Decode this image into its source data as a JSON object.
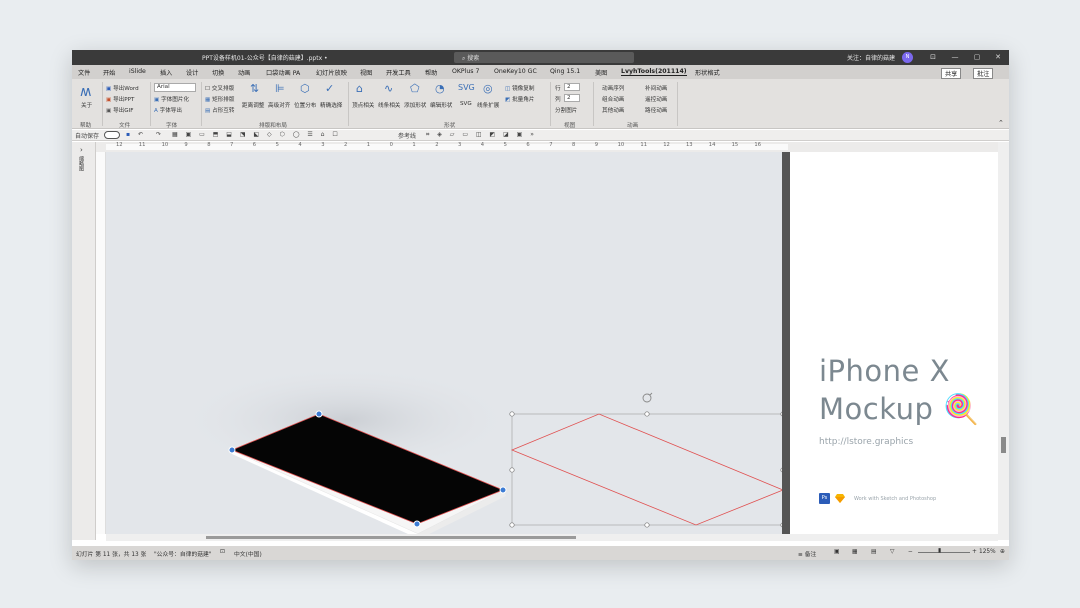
{
  "titlebar": {
    "filename": "PPT设备样机01-公众号【自律的菇建】.pptx  •",
    "search_placeholder": "搜索",
    "follow_text": "关注：自律的菇建",
    "avatar_initial": "N",
    "controls": [
      "⊡",
      "—",
      "▢",
      "✕"
    ]
  },
  "menu": {
    "items": [
      "文件",
      "开始",
      "iSlide",
      "插入",
      "设计",
      "切换",
      "动画",
      "口袋动画 PA",
      "幻灯片放映",
      "视图",
      "开发工具",
      "帮助",
      "OKPlus 7",
      "OneKey10 GC",
      "Qing 15.1",
      "美图",
      "LvyhTools(201114)",
      "形状格式"
    ],
    "active": "LvyhTools(201114)",
    "share": "共享",
    "comment": "批注"
  },
  "ribbon": {
    "help_label": "关于",
    "file_buttons": [
      "导出Word",
      "导出PPT",
      "导出GIF"
    ],
    "font_name": "Arial",
    "font_buttons": [
      "字体图片化",
      "字体导出"
    ],
    "layout_buttons": [
      "交叉排版",
      "矩形排版",
      "占形互转"
    ],
    "layout_large": [
      "距离调整",
      "高级对齐",
      "位置分布",
      "精确选择"
    ],
    "shape_large": [
      "顶点相关",
      "线条相关",
      "添加形状",
      "编辑形状",
      "SVG",
      "线条扩展"
    ],
    "shape_small": [
      "镜像复制",
      "批量角片"
    ],
    "view_rows": [
      "行",
      "列",
      "分割图片"
    ],
    "view_vals": [
      "2",
      "2"
    ],
    "anim_buttons": [
      "动画序列",
      "补间动画",
      "组合动画",
      "遥控动画",
      "其他动画",
      "路径动画"
    ],
    "groups": [
      "帮助",
      "文件",
      "字体",
      "排版和布局",
      "形状",
      "视图",
      "动画"
    ]
  },
  "qat": {
    "autosave": "自动保存",
    "items": [
      "参考线"
    ]
  },
  "ruler": {
    "labels": [
      "12",
      "11",
      "10",
      "9",
      "8",
      "7",
      "6",
      "5",
      "4",
      "3",
      "2",
      "1",
      "0",
      "1",
      "2",
      "3",
      "4",
      "5",
      "6",
      "7",
      "8",
      "9",
      "10",
      "11",
      "12",
      "13",
      "14",
      "15",
      "16"
    ]
  },
  "slide": {
    "title_line1": "iPhone X",
    "title_line2": "Mockup 🍭",
    "url": "http://lstore.graphics",
    "footer": "Work with Sketch and Photoshop",
    "ps_badge": "Ps"
  },
  "sidepanel": {
    "label": "缩略图"
  },
  "status": {
    "slide_info": "幻灯片 第 11 张，共 13 张",
    "account": "\"公众号：自律的菇建\"",
    "lang": "中文(中国)",
    "notes": "备注",
    "zoom": "125%"
  },
  "colors": {
    "titlebar": "#3a3a3a",
    "ribbon": "#e3e1df",
    "canvas": "#e3e6ea",
    "selection_red": "#e05050",
    "handle_blue": "#3b7bd4",
    "title_gray": "#7c8890"
  }
}
